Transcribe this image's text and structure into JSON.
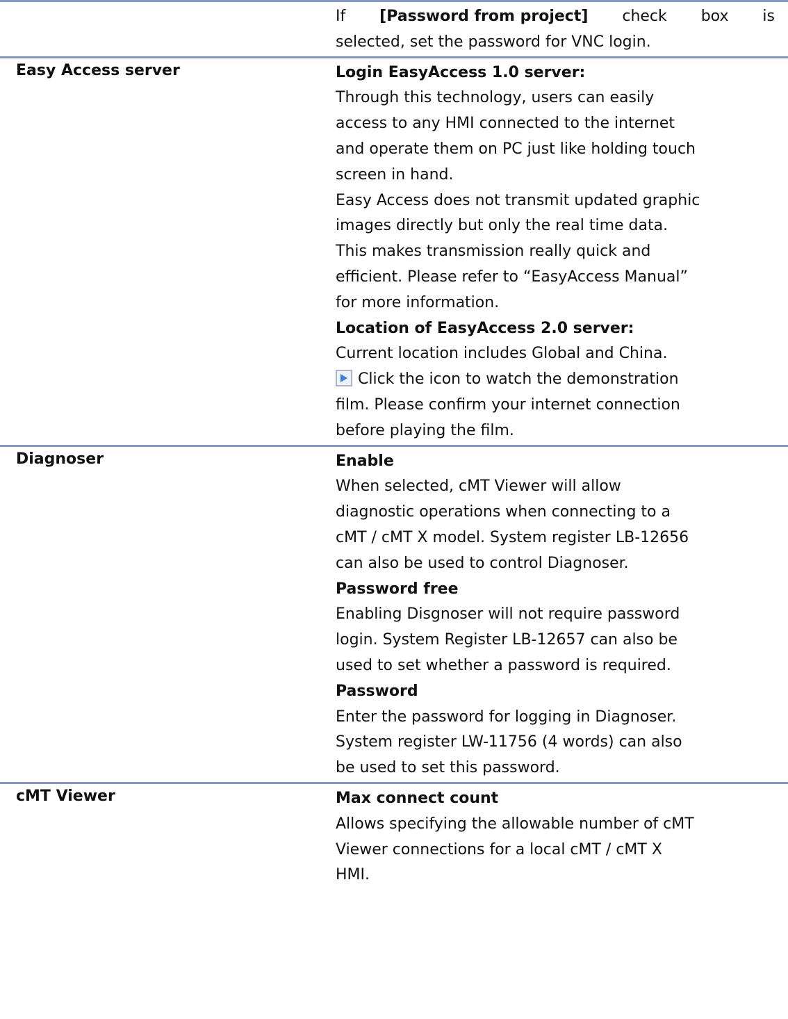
{
  "rows": [
    {
      "label": "",
      "intro_words": [
        "If",
        "[Password from project]",
        "check",
        "box",
        "is"
      ],
      "lines": [
        "selected, set the password for VNC login."
      ]
    },
    {
      "label": "Easy Access server",
      "heading1": "Login EasyAccess 1.0 server:",
      "lines1": [
        "Through this technology, users can easily",
        "access to any HMI connected to the internet",
        "and operate them on PC just like holding touch",
        "screen in hand.",
        "Easy Access does not transmit updated graphic",
        "images directly but only the real time data.",
        "This makes transmission really quick and",
        "efficient. Please refer to “EasyAccess Manual”",
        "for more information."
      ],
      "heading2": "Location of EasyAccess 2.0 server:",
      "lines2": [
        "Current location includes Global and China."
      ],
      "icon": "play-video-icon",
      "icon_line": "Click the icon to watch the demonstration",
      "lines3": [
        "film. Please confirm your internet connection",
        "before playing the film."
      ]
    },
    {
      "label": "Diagnoser",
      "sections": [
        {
          "heading": "Enable",
          "lines": [
            "When selected, cMT Viewer will allow",
            "diagnostic operations when connecting to a",
            "cMT / cMT X model. System register LB-12656",
            "can also be used to control Diagnoser."
          ]
        },
        {
          "heading": "Password free",
          "lines": [
            "Enabling Disgnoser will not require password",
            "login. System Register LB-12657 can also be",
            "used to set whether a password is required."
          ]
        },
        {
          "heading": "Password",
          "lines": [
            "Enter the password for logging in Diagnoser.",
            "System register LW-11756 (4 words) can also",
            "be used to set this password."
          ]
        }
      ]
    },
    {
      "label": "cMT Viewer",
      "heading": "Max connect count",
      "lines": [
        "Allows specifying the allowable number of cMT",
        "Viewer connections for a local cMT / cMT X",
        "HMI."
      ]
    }
  ]
}
